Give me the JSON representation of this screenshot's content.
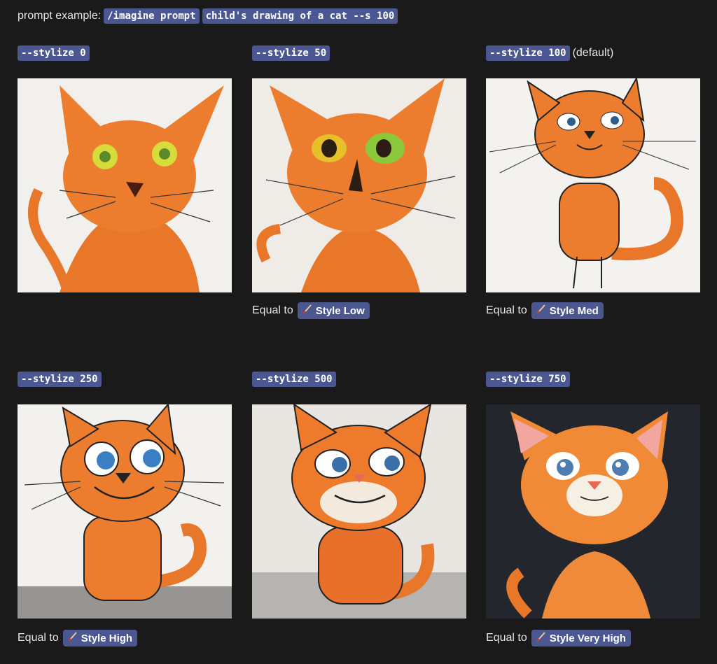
{
  "prompt": {
    "label": "prompt example:",
    "command": "/imagine prompt",
    "text": "child's drawing of a cat --s 100"
  },
  "cells": [
    {
      "param": "--stylize 0",
      "suffix": "",
      "equal_label": "",
      "style": ""
    },
    {
      "param": "--stylize 50",
      "suffix": "",
      "equal_label": "Equal to",
      "style": "Style Low"
    },
    {
      "param": "--stylize 100",
      "suffix": "(default)",
      "equal_label": "Equal to",
      "style": "Style Med"
    },
    {
      "param": "--stylize 250",
      "suffix": "",
      "equal_label": "Equal to",
      "style": "Style High"
    },
    {
      "param": "--stylize 500",
      "suffix": "",
      "equal_label": "",
      "style": ""
    },
    {
      "param": "--stylize 750",
      "suffix": "",
      "equal_label": "Equal to",
      "style": "Style Very High"
    }
  ],
  "colors": {
    "background": "#1a1a1b",
    "tag": "#4a5790",
    "cat_orange": "#e8772a"
  },
  "icons": {
    "style_pill": "paintbrush-icon"
  }
}
